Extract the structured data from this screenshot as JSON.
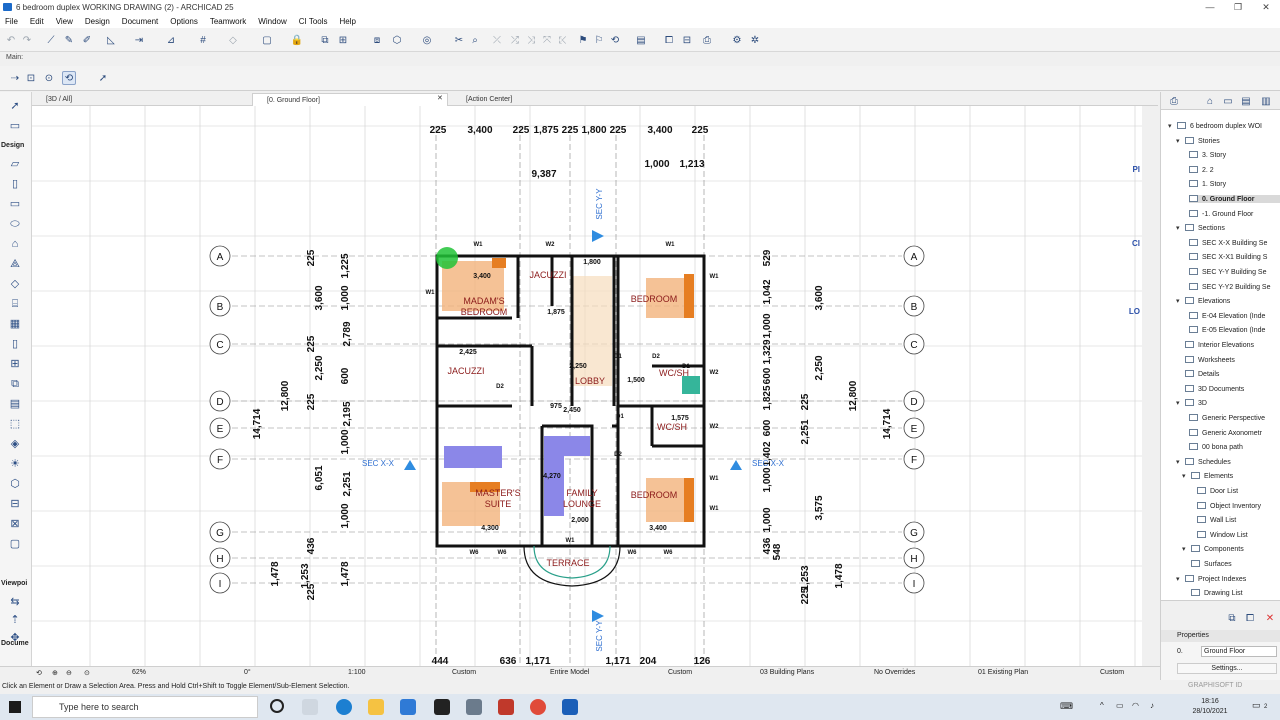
{
  "window": {
    "title": "6 bedroom duplex WORKING DRAWING (2) - ARCHICAD 25",
    "minimize": "—",
    "maximize": "❐",
    "close": "✕"
  },
  "menu": [
    "File",
    "Edit",
    "View",
    "Design",
    "Document",
    "Options",
    "Teamwork",
    "Window",
    "CI Tools",
    "Help"
  ],
  "toolbar": {
    "main_label": "Main:"
  },
  "toolbox": {
    "design_label": "Design",
    "viewpoint_label": "Viewpoi",
    "document_label": "Docume"
  },
  "tabs": [
    {
      "label": "[3D / All]"
    },
    {
      "label": "[0. Ground Floor]",
      "close": "✕"
    },
    {
      "label": "[Action Center]"
    }
  ],
  "navigator": {
    "project": "6 bedroom duplex WOI",
    "stories_label": "Stories",
    "stories": [
      "3. Story",
      "2. 2",
      "1. Story",
      "0. Ground Floor",
      "-1. Ground Floor"
    ],
    "selected_story": "0. Ground Floor",
    "sections_label": "Sections",
    "sections": [
      "SEC X-X Building Se",
      "SEC X-X1 Building S",
      "SEC Y-Y Building Se",
      "SEC Y-Y2 Building Se"
    ],
    "elevations_label": "Elevations",
    "elevations": [
      "E-04 Elevation (Inde",
      "E-05 Elevation (Inde"
    ],
    "other_items": [
      "Interior Elevations",
      "Worksheets",
      "Details",
      "3D Documents"
    ],
    "three_d_label": "3D",
    "three_d_items": [
      "Generic Perspective",
      "Generic Axonometr",
      "00 bona path"
    ],
    "schedules_label": "Schedules",
    "elements_label": "Elements",
    "element_items": [
      "Door List",
      "Object Inventory",
      "Wall List",
      "Window List"
    ],
    "components_label": "Components",
    "surfaces_label": "Surfaces",
    "project_indexes_label": "Project Indexes",
    "drawing_list": "Drawing List"
  },
  "properties": {
    "header": "Properties",
    "story_num": "0.",
    "story_value": "Ground Floor",
    "settings": "Settings..."
  },
  "statusbar": {
    "zoom": "62%",
    "angle": "0°",
    "scale": "1:100",
    "layer_combo": "Custom",
    "model_view": "Entire Model",
    "pen_set": "Custom",
    "building_plans": "03 Building Plans",
    "overrides": "No Overrides",
    "renovation": "01 Existing Plan",
    "dimension": "Custom"
  },
  "hint": "Click an Element or Draw a Selection Area. Press and Hold Ctrl+Shift to Toggle Element/Sub-Element Selection.",
  "graphisoft": "GRAPHISOFT ID",
  "taskbar": {
    "search_placeholder": "Type here to search",
    "time": "18:16",
    "date": "28/10/2021",
    "notif": "2"
  },
  "plan": {
    "grid_rows": [
      "A",
      "B",
      "C",
      "D",
      "E",
      "F",
      "G",
      "H",
      "I"
    ],
    "top_dims": [
      "225",
      "3,400",
      "225",
      "1,875",
      "225",
      "1,800",
      "225",
      "3,400",
      "225"
    ],
    "top_dims2": [
      "1,000",
      "1,213"
    ],
    "top_total": "9,387",
    "bottom_dims": [
      "444",
      "636",
      "1,171",
      "1,171",
      "204",
      "126"
    ],
    "left_dims": [
      "225",
      "1,225",
      "3,600",
      "1,000",
      "2,789",
      "225",
      "2,250",
      "600",
      "225",
      "2,195",
      "1,000",
      "6,051",
      "2,251",
      "1,000",
      "436",
      "1,478",
      "1,253",
      "225",
      "1,478",
      "12,800",
      "14,714"
    ],
    "right_dims": [
      "529",
      "1,042",
      "3,600",
      "1,000",
      "1,329",
      "2,250",
      "600",
      "1,825",
      "225",
      "2,251",
      "600",
      "1,402",
      "1,000",
      "3,575",
      "1,000",
      "436",
      "548",
      "1,253",
      "225",
      "1,478",
      "12,800",
      "14,714"
    ],
    "rooms": [
      "MADAM'S BEDROOM",
      "JACUZZI",
      "JACUZZI",
      "BEDROOM",
      "LOBBY",
      "WC/SH",
      "WC/SH",
      "MASTER'S SUITE",
      "FAMILY LOUNGE",
      "BEDROOM",
      "TERRACE"
    ],
    "room_dims": [
      "3,400",
      "2,425",
      "1,800",
      "1,500",
      "1,875",
      "975",
      "4,270",
      "2,000",
      "4,300",
      "3,400",
      "1,575",
      "2,250",
      "2,450"
    ],
    "section_marks": [
      "SEC Y-Y",
      "SEC X-X",
      "SEC X-X",
      "SEC Y-Y"
    ],
    "openings": [
      "W1",
      "W2",
      "W1",
      "W1",
      "W1",
      "D1",
      "D2",
      "D1",
      "D2",
      "D1",
      "D2",
      "W2",
      "W2",
      "W1",
      "W1",
      "W6",
      "W6",
      "W1",
      "W6",
      "W6"
    ],
    "edge_labels": [
      "Pl",
      "Cl",
      "LO"
    ]
  }
}
